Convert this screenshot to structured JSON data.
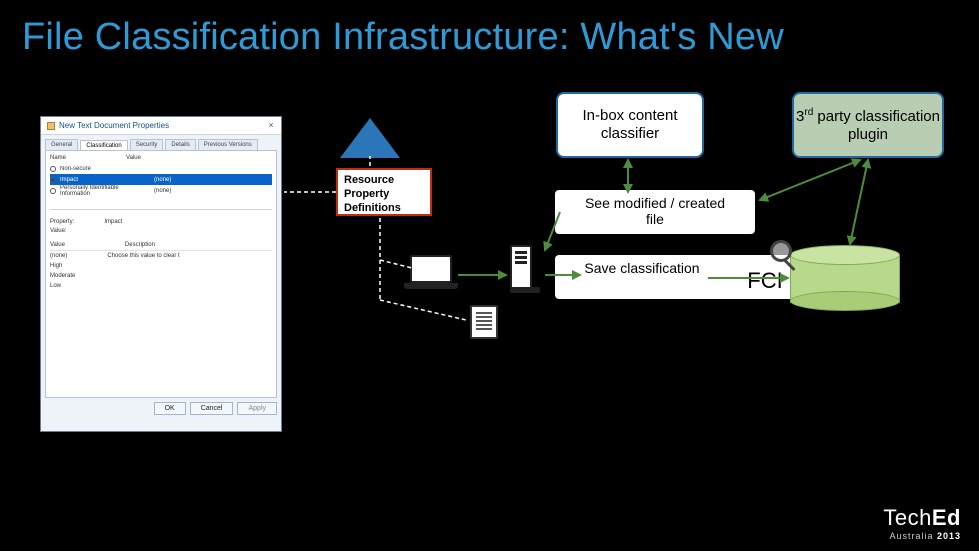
{
  "title": "File Classification Infrastructure: What's New",
  "dialog": {
    "title": "New Text Document Properties",
    "close": "×",
    "tabs": [
      "General",
      "Classification",
      "Security",
      "Details",
      "Previous Versions"
    ],
    "active_tab": 1,
    "col_name": "Name",
    "col_value": "Value",
    "props": [
      {
        "name": "Non-secure",
        "value": ""
      },
      {
        "name": "Impact",
        "value": "(none)",
        "selected": true
      },
      {
        "name": "Personally Identifiable Information",
        "value": "(none)"
      }
    ],
    "lower": {
      "property_label": "Property:",
      "property_value": "Impact",
      "value_label": "Value:",
      "col_value": "Value",
      "col_desc": "Description",
      "rows": [
        {
          "value": "(none)",
          "desc": "Choose this value to clear t"
        },
        {
          "value": "High",
          "desc": ""
        },
        {
          "value": "Moderate",
          "desc": ""
        },
        {
          "value": "Low",
          "desc": ""
        }
      ]
    },
    "buttons": {
      "ok": "OK",
      "cancel": "Cancel",
      "apply": "Apply"
    }
  },
  "diagram": {
    "rpd": "Resource Property Definitions",
    "inbox": "In-box content classifier",
    "plugin_line1": "3",
    "plugin_sup": "rd",
    "plugin_line2": " party classification plugin",
    "see_modified": "See modified / created file",
    "save_classification": "Save classification",
    "fci": "FCI"
  },
  "footer": {
    "brand_a": "Tech",
    "brand_b": "Ed",
    "sub_a": "Australia ",
    "sub_b": "2013"
  }
}
